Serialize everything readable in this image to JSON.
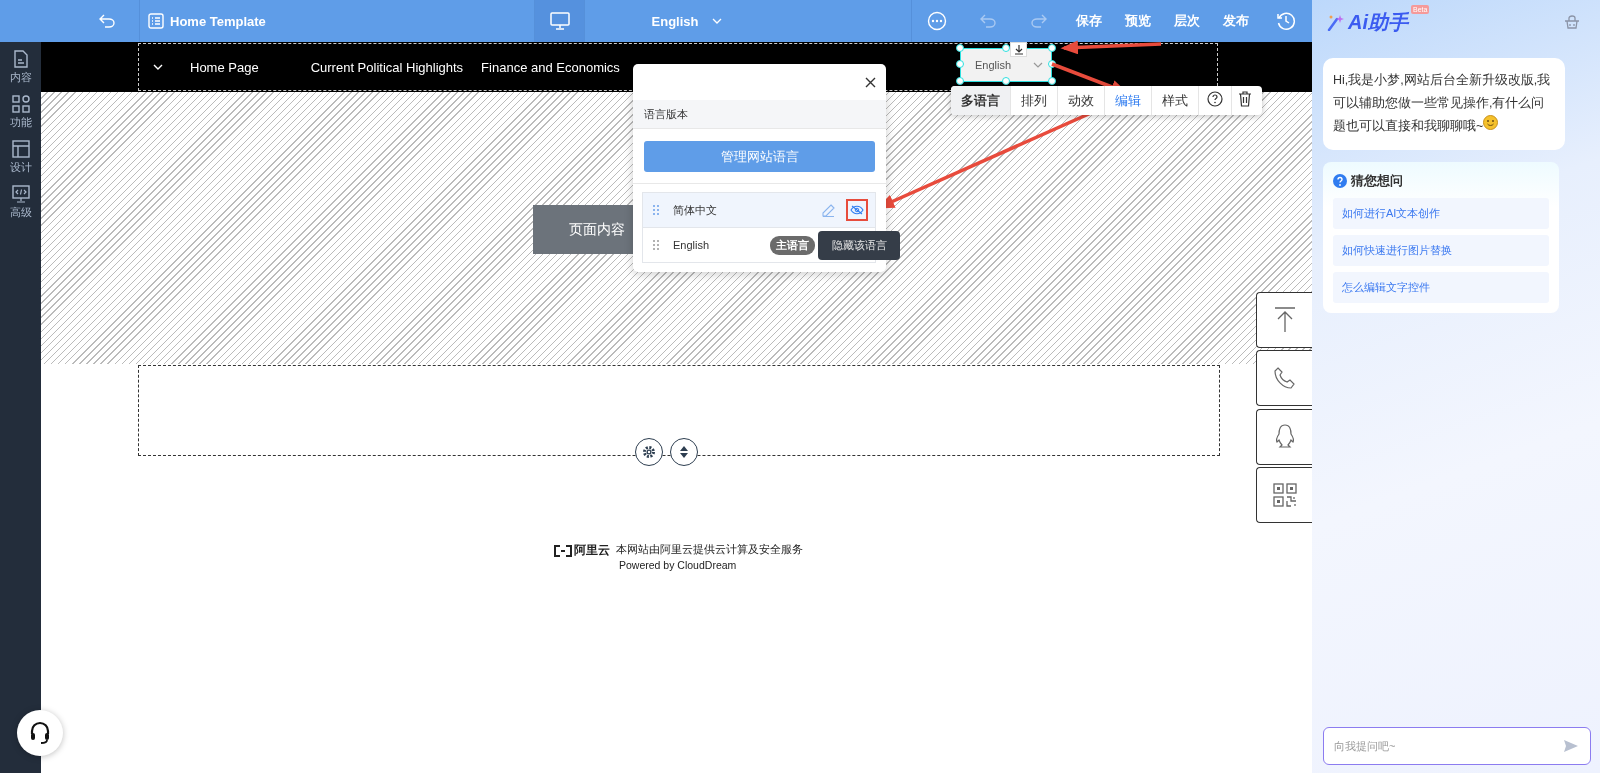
{
  "top_bar": {
    "template": "Home Template",
    "language": "English",
    "actions": [
      {
        "label": "保存"
      },
      {
        "label": "预览"
      },
      {
        "label": "层次"
      },
      {
        "label": "发布"
      }
    ]
  },
  "sidebar": {
    "items": [
      {
        "label": "内容",
        "kind": "content"
      },
      {
        "label": "功能",
        "kind": "modules"
      },
      {
        "label": "设计",
        "kind": "layout"
      },
      {
        "label": "高级",
        "kind": "code"
      }
    ]
  },
  "nav": {
    "items": [
      "Home Page",
      "Current Political Highlights",
      "Finance and Economics"
    ]
  },
  "language_widget": {
    "value": "English"
  },
  "element_toolbar": {
    "tabs": [
      {
        "label": "多语言",
        "selected": true,
        "hovered": false
      },
      {
        "label": "排列",
        "selected": false,
        "hovered": false
      },
      {
        "label": "动效",
        "selected": false,
        "hovered": false
      },
      {
        "label": "编辑",
        "selected": false,
        "hovered": true
      },
      {
        "label": "样式",
        "selected": false,
        "hovered": false
      }
    ]
  },
  "content_area": {
    "label": "页面内容"
  },
  "language_popup": {
    "section_title": "语言版本",
    "manage_button": "管理网站语言",
    "languages": [
      {
        "name": "简体中文",
        "hovered": true
      },
      {
        "name": "English",
        "hovered": false,
        "tag": "主语言"
      }
    ],
    "tooltip": "隐藏该语言"
  },
  "footer": {
    "logo_text": "阿里云",
    "provider": "本网站由阿里云提供云计算及安全服务",
    "powered": "Powered by CloudDream"
  },
  "assistant": {
    "title": "Ai助手",
    "badge": "Beta",
    "greeting": "Hi,我是小梦,网站后台全新升级改版,我可以辅助您做一些常见操作,有什么问题也可以直接和我聊聊哦~",
    "suggest_title": "猜您想问",
    "suggestions": [
      "如何进行AI文本创作",
      "如何快速进行图片替换",
      "怎么编辑文字控件"
    ],
    "input": {
      "placeholder": "向我提问吧~"
    }
  }
}
